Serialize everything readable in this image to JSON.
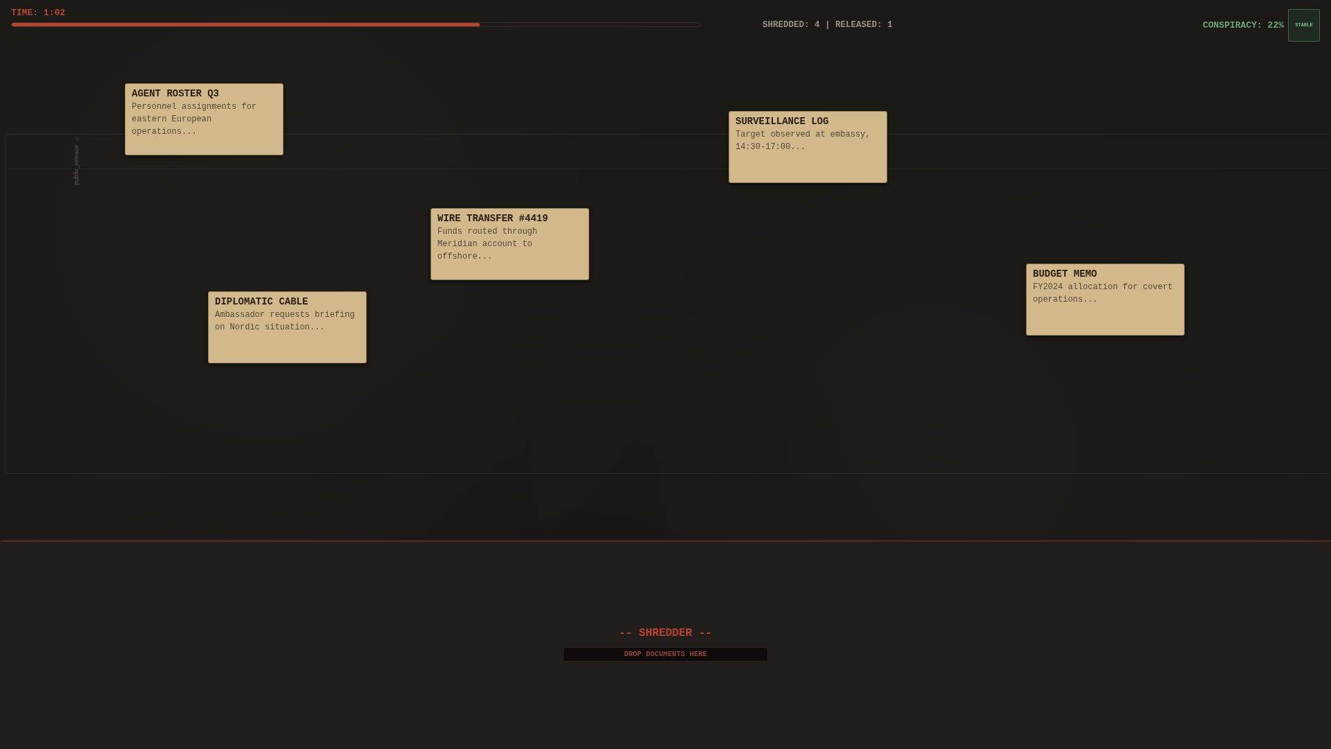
{
  "timer": {
    "label": "TIME: 1:02",
    "level": 0.68
  },
  "stats": {
    "text": "SHREDDED: 4 | RELEASED: 1"
  },
  "conspiracy": {
    "label": "CONSPIRACY: 22%",
    "status": "STABLE"
  },
  "release_zone": {
    "label": "public_release →"
  },
  "documents": [
    {
      "title": "AGENT ROSTER Q3",
      "text": "Personnel assignments for eastern European operations..."
    },
    {
      "title": "SURVEILLANCE LOG",
      "text": "Target observed at embassy, 14:30-17:00..."
    },
    {
      "title": "WIRE TRANSFER #4419",
      "text": "Funds routed through Meridian account to offshore..."
    },
    {
      "title": "BUDGET MEMO",
      "text": "FY2024 allocation for covert operations..."
    },
    {
      "title": "DIPLOMATIC CABLE",
      "text": "Ambassador requests briefing on Nordic situation..."
    }
  ],
  "shredder": {
    "title": "-- SHREDDER --",
    "slot": "DROP DOCUMENTS HERE"
  }
}
